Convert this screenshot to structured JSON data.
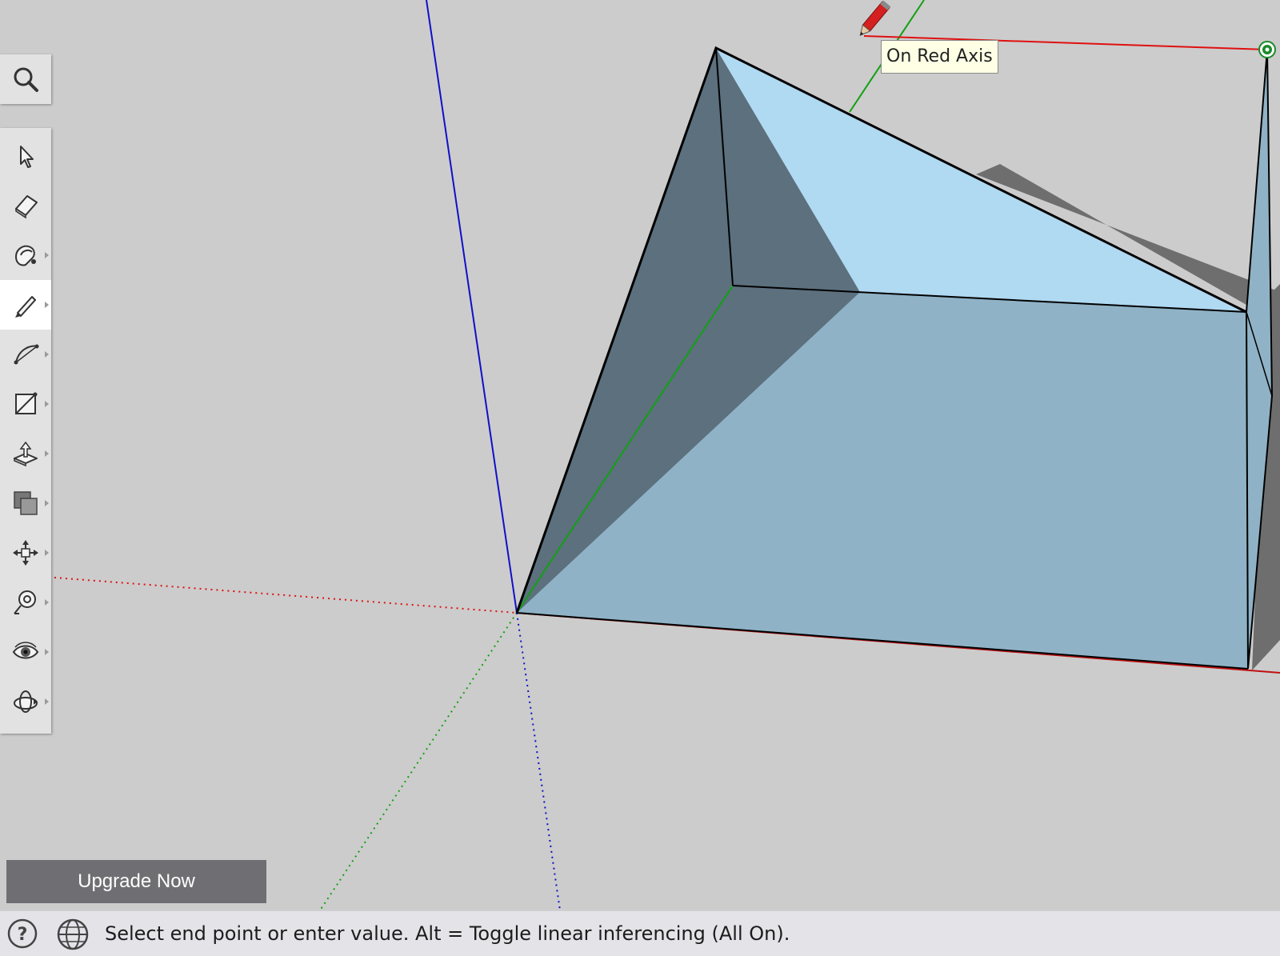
{
  "app": {
    "colors": {
      "background": "#cccccc",
      "axis_red": "#e01010",
      "axis_green": "#12a012",
      "axis_blue": "#1010c8",
      "face_top": "#b0d9f2",
      "face_front": "#8fb2c6",
      "face_shade": "#5c707e",
      "shadow": "#6e6e6e",
      "toolbar_bg": "#e2e2e2",
      "status_bg": "#e3e3e8",
      "upgrade_bg": "#6f6f73"
    }
  },
  "viewport": {
    "tooltip": "On Red Axis",
    "cursor_icon": "pencil-cursor-icon",
    "endpoint_marker": "green-endpoint-icon"
  },
  "toolbar": {
    "search_icon": "search-icon",
    "tools": [
      {
        "icon": "select-arrow-icon",
        "has_flyout": false,
        "active": false
      },
      {
        "icon": "eraser-icon",
        "has_flyout": false,
        "active": false
      },
      {
        "icon": "paint-bucket-icon",
        "has_flyout": true,
        "active": false
      },
      {
        "icon": "pencil-icon",
        "has_flyout": true,
        "active": true
      },
      {
        "icon": "arc-icon",
        "has_flyout": true,
        "active": false
      },
      {
        "icon": "rectangle-icon",
        "has_flyout": true,
        "active": false
      },
      {
        "icon": "push-pull-icon",
        "has_flyout": true,
        "active": false
      },
      {
        "icon": "offset-icon",
        "has_flyout": true,
        "active": false
      },
      {
        "icon": "move-icon",
        "has_flyout": true,
        "active": false
      },
      {
        "icon": "tape-measure-icon",
        "has_flyout": true,
        "active": false
      },
      {
        "icon": "eye-icon",
        "has_flyout": true,
        "active": false
      },
      {
        "icon": "orbit-icon",
        "has_flyout": true,
        "active": false
      }
    ]
  },
  "upgrade": {
    "label": "Upgrade Now"
  },
  "status": {
    "help_icon": "help-icon",
    "globe_icon": "globe-icon",
    "text": "Select end point or enter value. Alt = Toggle linear inferencing (All On)."
  }
}
